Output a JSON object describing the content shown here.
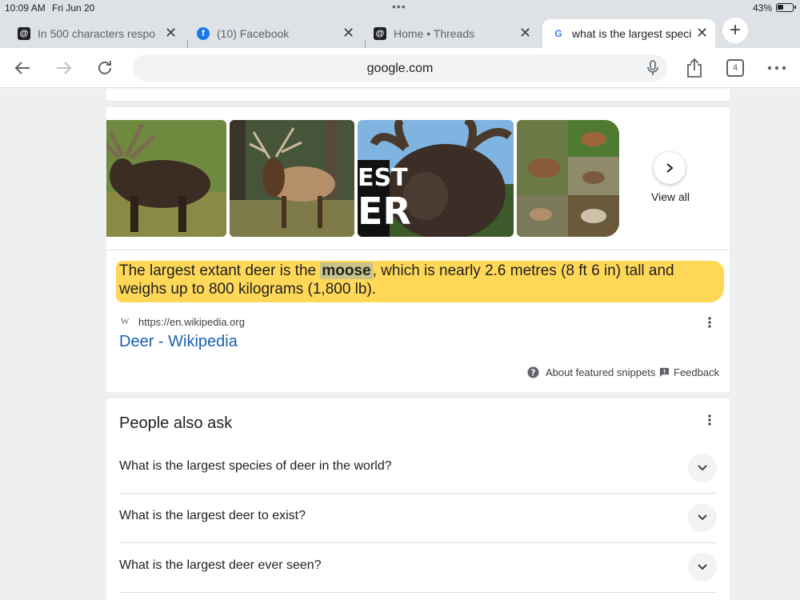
{
  "status": {
    "time": "10:09 AM",
    "date": "Fri Jun 20",
    "dots": "•••",
    "battery": "43%"
  },
  "tabs": [
    {
      "title": "In 500 characters respo",
      "favicon": "threads-like-icon"
    },
    {
      "title": "(10) Facebook",
      "favicon": "facebook-icon"
    },
    {
      "title": "Home • Threads",
      "favicon": "threads-icon"
    },
    {
      "title": "what is the largest speci",
      "favicon": "google-icon",
      "active": true
    }
  ],
  "toolbar": {
    "url": "google.com",
    "tab_count": "4"
  },
  "images": {
    "view_all": "View all",
    "overlay1": "EST",
    "overlay2": "ER"
  },
  "snippet": {
    "before": "The largest extant deer is the ",
    "highlight": "moose",
    "after": ", which is nearly 2.6 metres (8 ft 6 in) tall and weighs up to 800 kilograms (1,800 lb).",
    "source_icon": "W",
    "source_url": "https://en.wikipedia.org",
    "source_title": "Deer - Wikipedia",
    "about": "About featured snippets",
    "feedback": "Feedback"
  },
  "paa": {
    "title": "People also ask",
    "questions": [
      "What is the largest species of deer in the world?",
      "What is the largest deer to exist?",
      "What is the largest deer ever seen?"
    ]
  },
  "colors": {
    "highlight": "#ffd54a",
    "link": "#1a5fb4",
    "chrome": "#dee1e6"
  }
}
